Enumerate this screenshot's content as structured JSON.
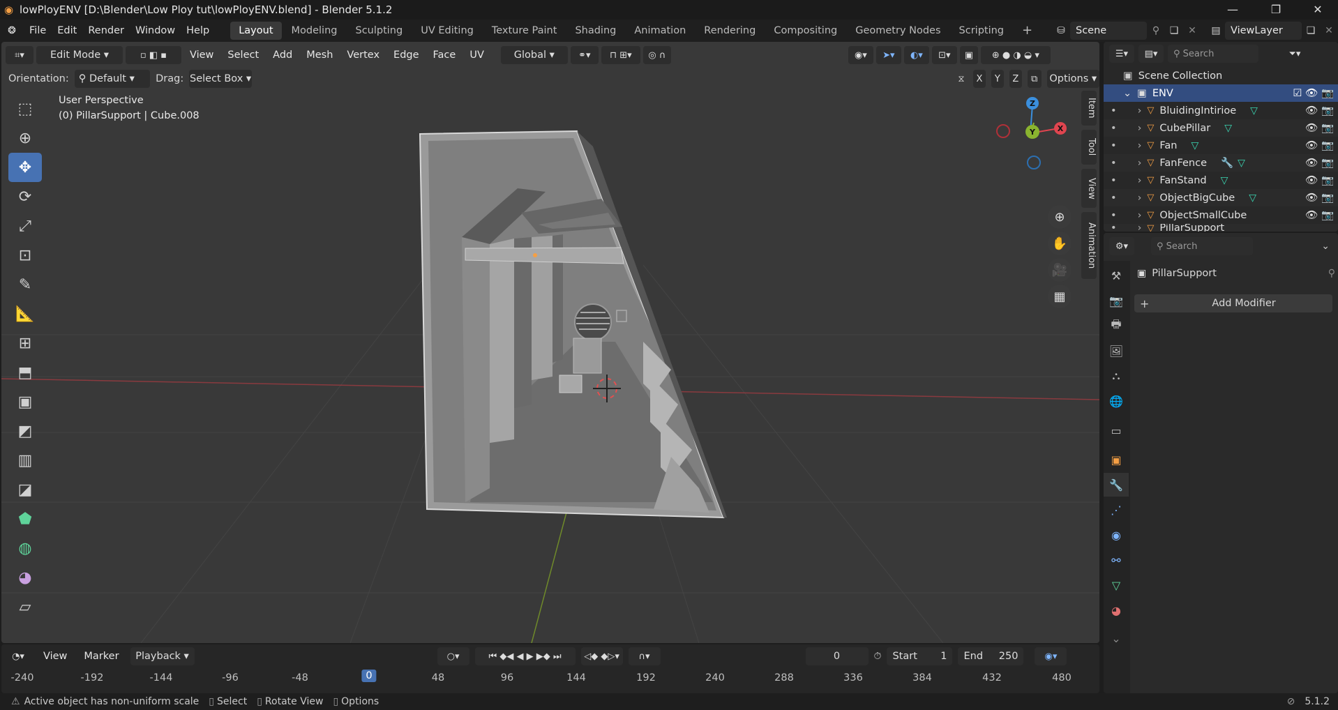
{
  "titlebar": {
    "title": "lowPloyENV [D:\\Blender\\Low Ploy tut\\lowPloyENV.blend] - Blender 5.1.2",
    "minimize": "—",
    "maximize": "❐",
    "close": "✕"
  },
  "menubar": {
    "menus": [
      "File",
      "Edit",
      "Render",
      "Window",
      "Help"
    ],
    "workspaces": [
      "Layout",
      "Modeling",
      "Sculpting",
      "UV Editing",
      "Texture Paint",
      "Shading",
      "Animation",
      "Rendering",
      "Compositing",
      "Geometry Nodes",
      "Scripting"
    ],
    "active_workspace": "Layout",
    "add_workspace": "+",
    "scene": "Scene",
    "view_layer": "ViewLayer"
  },
  "viewport_header": {
    "mode": "Edit Mode",
    "menus": [
      "View",
      "Select",
      "Add",
      "Mesh",
      "Vertex",
      "Edge",
      "Face",
      "UV"
    ],
    "transform_orientation": "Global"
  },
  "tool_settings": {
    "orientation_label": "Orientation:",
    "orientation_value": "Default",
    "drag_label": "Drag:",
    "drag_value": "Select Box",
    "axis_x": "X",
    "axis_y": "Y",
    "axis_z": "Z",
    "options": "Options"
  },
  "viewport": {
    "perspective": "User Perspective",
    "object_info": "(0) PillarSupport | Cube.008",
    "side_tabs": [
      "Item",
      "Tool",
      "View",
      "Animation"
    ],
    "gizmo": {
      "z": "Z",
      "y": "Y",
      "x": "X"
    }
  },
  "outliner": {
    "search_placeholder": "Search",
    "root": "Scene Collection",
    "collection": "ENV",
    "objects": [
      "BluidingIntirioe",
      "CubePillar",
      "Fan",
      "FanFence",
      "FanStand",
      "ObjectBigCube",
      "ObjectSmallCube",
      "PillarSupport"
    ]
  },
  "properties": {
    "search_placeholder": "Search",
    "object_name": "PillarSupport",
    "add_modifier": "Add Modifier"
  },
  "timeline": {
    "menus": [
      "View",
      "Marker"
    ],
    "playback": "Playback",
    "current_frame": "0",
    "start_label": "Start",
    "start_value": "1",
    "end_label": "End",
    "end_value": "250",
    "ruler": [
      "-240",
      "-192",
      "-144",
      "-96",
      "-48",
      "0",
      "48",
      "96",
      "144",
      "192",
      "240",
      "288",
      "336",
      "384",
      "432",
      "480"
    ]
  },
  "statusbar": {
    "warning": "Active object has non-uniform scale",
    "select": "Select",
    "rotate_view": "Rotate View",
    "options": "Options",
    "version": "5.1.2"
  },
  "colors": {
    "accent": "#4772b3",
    "x_axis": "#e0454f",
    "y_axis": "#8ab42f",
    "z_axis": "#3b8fdd",
    "object_orange": "#f59f44"
  }
}
